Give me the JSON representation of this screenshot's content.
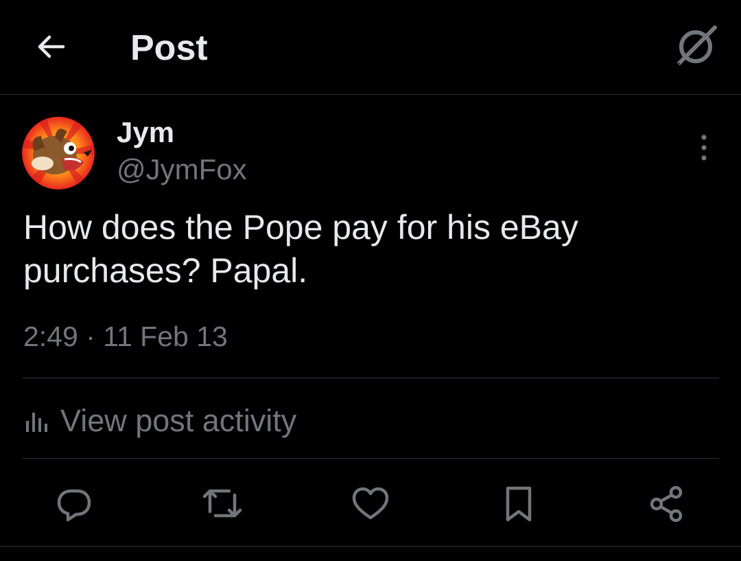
{
  "header": {
    "title": "Post",
    "back_icon": "arrow-left-icon",
    "grok_icon": "grok-icon"
  },
  "post": {
    "author": {
      "display_name": "Jym",
      "handle": "@JymFox",
      "avatar": "fox-avatar"
    },
    "text": "How does the Pope pay for his eBay purchases? Papal.",
    "timestamp": "2:49 · 11 Feb 13"
  },
  "activity": {
    "icon": "analytics-icon",
    "label": "View post activity"
  },
  "actions": [
    {
      "name": "reply",
      "icon": "reply-icon"
    },
    {
      "name": "repost",
      "icon": "repost-icon"
    },
    {
      "name": "like",
      "icon": "like-icon"
    },
    {
      "name": "bookmark",
      "icon": "bookmark-icon"
    },
    {
      "name": "share",
      "icon": "share-icon"
    }
  ],
  "colors": {
    "background": "#000000",
    "text_primary": "#e7e9ea",
    "text_secondary": "#71767b",
    "divider": "#2f3336"
  }
}
